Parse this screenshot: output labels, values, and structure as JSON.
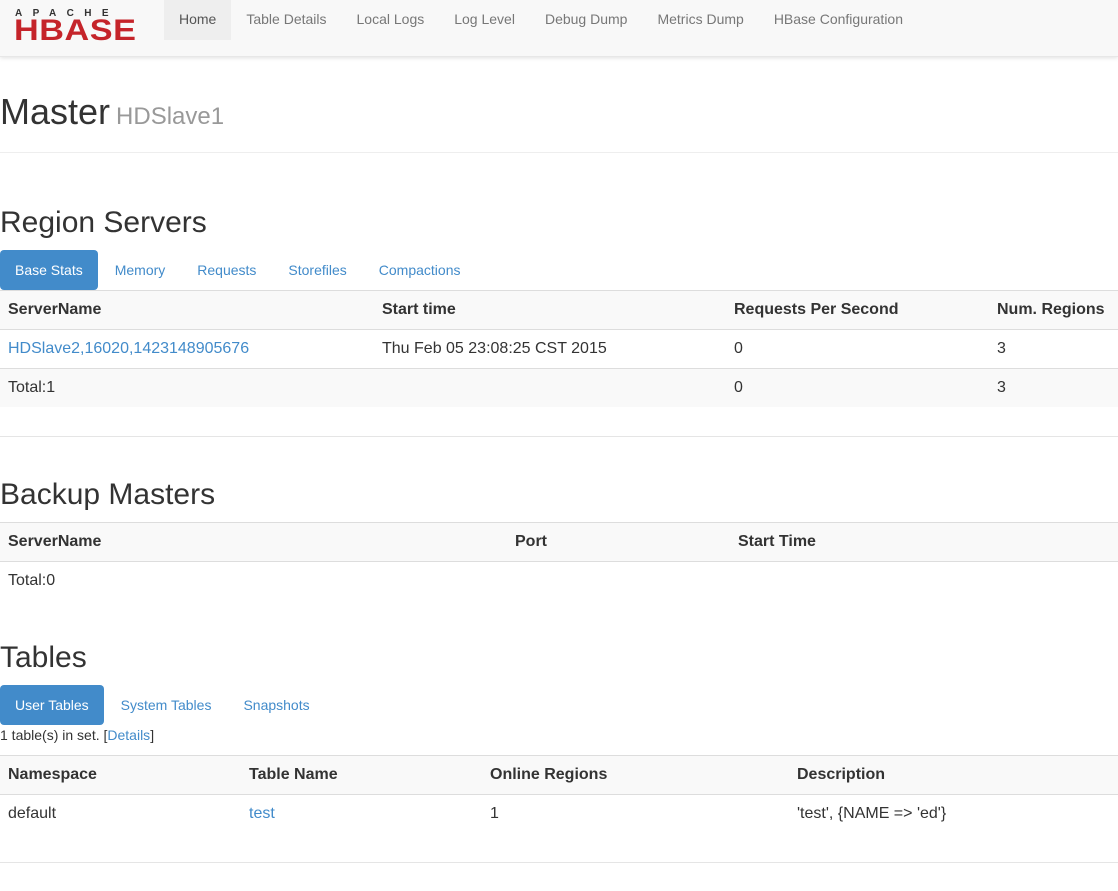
{
  "brand": {
    "small_text": "APACHE",
    "big_text": "HBASE",
    "big_color": "#c5242a"
  },
  "nav": {
    "items": [
      {
        "label": "Home",
        "active": true
      },
      {
        "label": "Table Details",
        "active": false
      },
      {
        "label": "Local Logs",
        "active": false
      },
      {
        "label": "Log Level",
        "active": false
      },
      {
        "label": "Debug Dump",
        "active": false
      },
      {
        "label": "Metrics Dump",
        "active": false
      },
      {
        "label": "HBase Configuration",
        "active": false
      }
    ]
  },
  "header": {
    "title": "Master",
    "subtitle": "HDSlave1"
  },
  "region_servers": {
    "title": "Region Servers",
    "tabs": [
      {
        "label": "Base Stats",
        "active": true
      },
      {
        "label": "Memory",
        "active": false
      },
      {
        "label": "Requests",
        "active": false
      },
      {
        "label": "Storefiles",
        "active": false
      },
      {
        "label": "Compactions",
        "active": false
      }
    ],
    "columns": [
      "ServerName",
      "Start time",
      "Requests Per Second",
      "Num. Regions"
    ],
    "rows": [
      {
        "server": "HDSlave2,16020,1423148905676",
        "start_time": "Thu Feb 05 23:08:25 CST 2015",
        "rps": "0",
        "regions": "3"
      }
    ],
    "total": {
      "label": "Total:1",
      "rps": "0",
      "regions": "3"
    }
  },
  "backup_masters": {
    "title": "Backup Masters",
    "columns": [
      "ServerName",
      "Port",
      "Start Time"
    ],
    "total": "Total:0"
  },
  "tables": {
    "title": "Tables",
    "tabs": [
      {
        "label": "User Tables",
        "active": true
      },
      {
        "label": "System Tables",
        "active": false
      },
      {
        "label": "Snapshots",
        "active": false
      }
    ],
    "count_prefix": "1 table(s) in set. [",
    "details_link": "Details",
    "count_suffix": "]",
    "columns": [
      "Namespace",
      "Table Name",
      "Online Regions",
      "Description"
    ],
    "rows": [
      {
        "namespace": "default",
        "name": "test",
        "online_regions": "1",
        "description": "'test', {NAME => 'ed'}"
      }
    ]
  },
  "colors": {
    "link": "#428bca",
    "pill_active_bg": "#428bca",
    "table_stripe": "#f9f9f9"
  }
}
